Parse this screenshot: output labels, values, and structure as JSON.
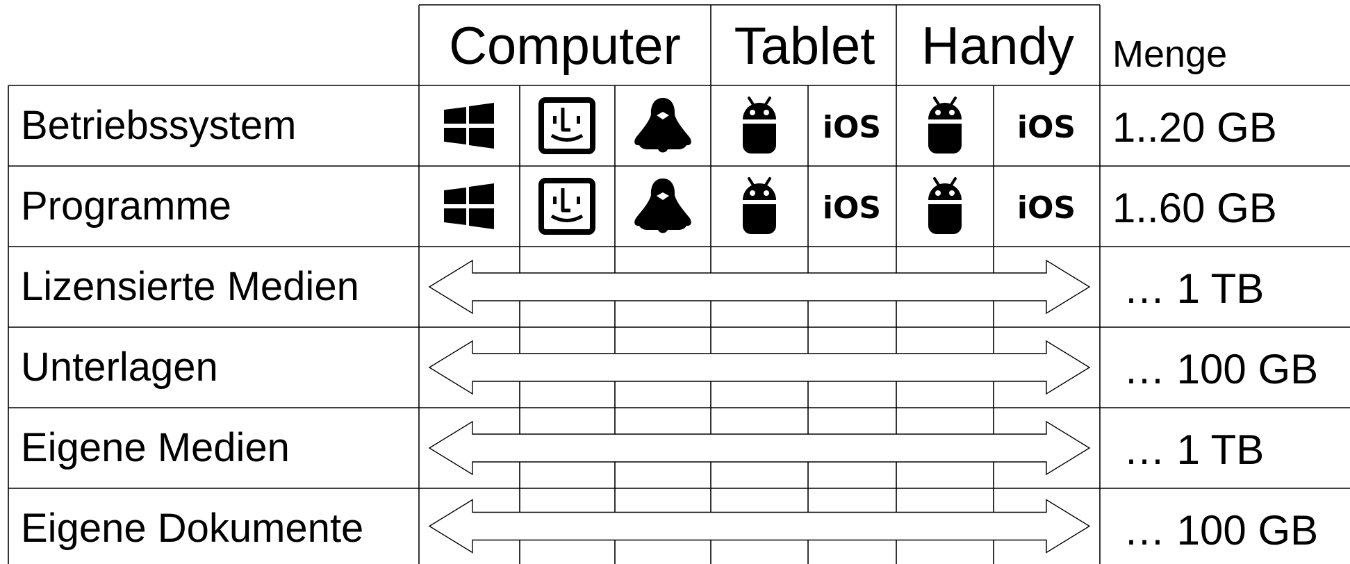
{
  "headers": {
    "groups": [
      "Computer",
      "Tablet",
      "Handy"
    ],
    "amount": "Menge"
  },
  "os_icons": {
    "computer": [
      "windows-icon",
      "finder-icon",
      "linux-tux-icon"
    ],
    "tablet": [
      "android-icon",
      "ios-icon"
    ],
    "handy": [
      "android-icon",
      "ios-icon"
    ],
    "ios_label": "iOS"
  },
  "rows": [
    {
      "label": "Betriebssystem",
      "kind": "per-platform",
      "amount": "1..20 GB"
    },
    {
      "label": "Programme",
      "kind": "per-platform",
      "amount": "1..60 GB"
    },
    {
      "label": "Lizensierte Medien",
      "kind": "shared",
      "amount": "… 1 TB"
    },
    {
      "label": "Unterlagen",
      "kind": "shared",
      "amount": "… 100 GB"
    },
    {
      "label": "Eigene Medien",
      "kind": "shared",
      "amount": "… 1 TB"
    },
    {
      "label": "Eigene Dokumente",
      "kind": "shared",
      "amount": "… 100 GB"
    }
  ]
}
